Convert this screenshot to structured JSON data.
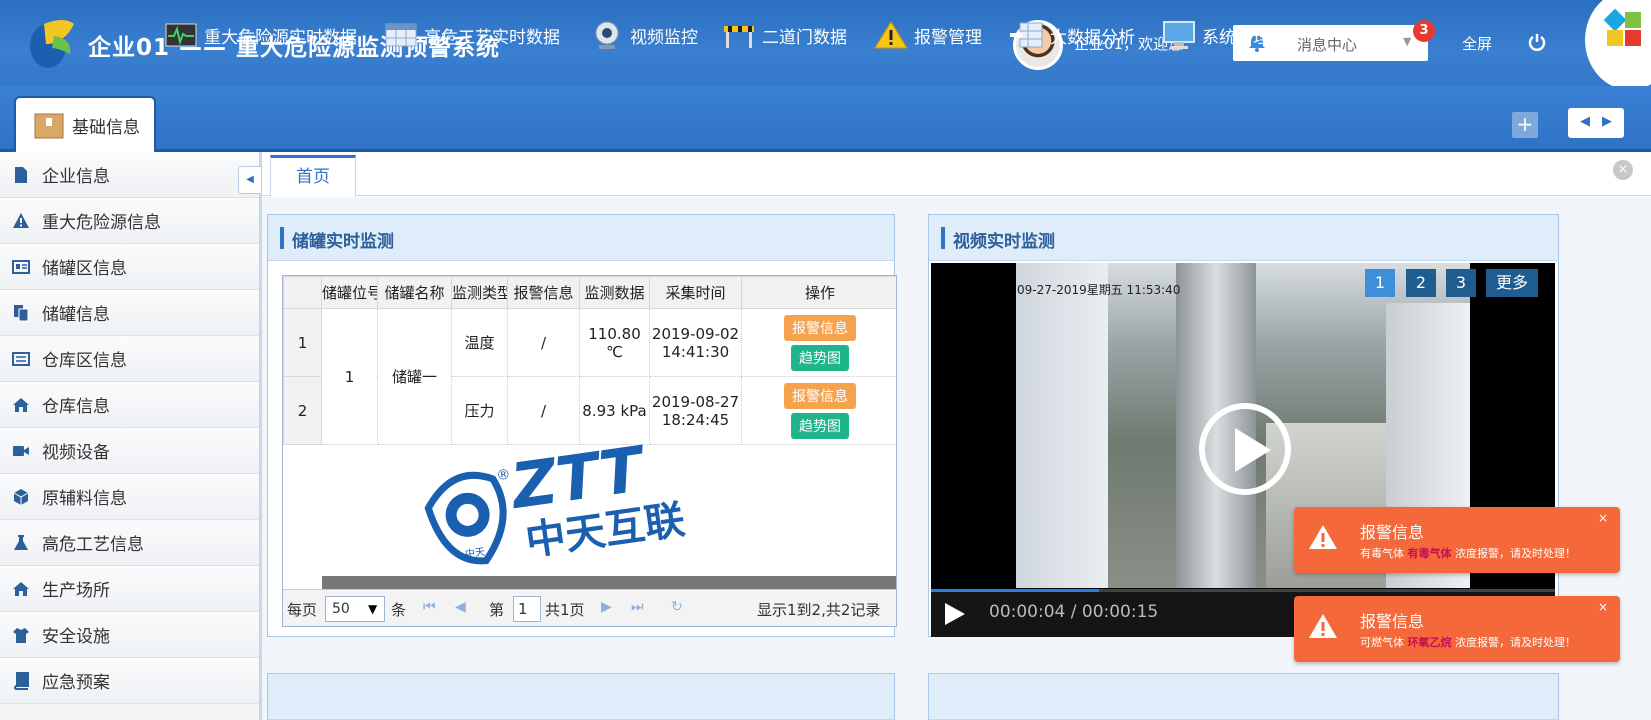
{
  "header": {
    "app_title": "企业01 —— 重大危险源监测预警系统",
    "welcome": "企业01，欢迎您",
    "message_center": "消息中心",
    "message_count": "3",
    "fullscreen": "全屏"
  },
  "nav": {
    "items": [
      {
        "label": "基础信息",
        "icon": "box-icon"
      },
      {
        "label": "重大危险源实时数据",
        "icon": "monitor-wave-icon"
      },
      {
        "label": "高危工艺实时数据",
        "icon": "grid-table-icon"
      },
      {
        "label": "视频监控",
        "icon": "webcam-icon"
      },
      {
        "label": "二道门数据",
        "icon": "barrier-gate-icon"
      },
      {
        "label": "报警管理",
        "icon": "warning-icon"
      },
      {
        "label": "大数据分析",
        "icon": "data-import-icon"
      },
      {
        "label": "系统管理",
        "icon": "computer-icon"
      }
    ],
    "plus": "+"
  },
  "sidebar": {
    "items": [
      {
        "label": "企业信息",
        "icon": "document-icon"
      },
      {
        "label": "重大危险源信息",
        "icon": "warning-icon"
      },
      {
        "label": "储罐区信息",
        "icon": "id-card-icon"
      },
      {
        "label": "储罐信息",
        "icon": "copy-icon"
      },
      {
        "label": "仓库区信息",
        "icon": "list-card-icon"
      },
      {
        "label": "仓库信息",
        "icon": "home-icon"
      },
      {
        "label": "视频设备",
        "icon": "video-camera-icon"
      },
      {
        "label": "原辅料信息",
        "icon": "cube-icon"
      },
      {
        "label": "高危工艺信息",
        "icon": "flask-icon"
      },
      {
        "label": "生产场所",
        "icon": "home-icon"
      },
      {
        "label": "安全设施",
        "icon": "shirt-icon"
      },
      {
        "label": "应急预案",
        "icon": "book-icon"
      }
    ]
  },
  "tabs": {
    "home": "首页",
    "close": "×"
  },
  "tank_panel": {
    "title": "储罐实时监测",
    "columns": [
      "",
      "储罐位号",
      "储罐名称",
      "监测类型",
      "报警信息",
      "监测数据",
      "采集时间",
      "操作"
    ],
    "rows": [
      {
        "no": "1",
        "tank_no": "1",
        "tank_name": "储罐一",
        "type": "温度",
        "alarm": "/",
        "value": "110.80 ℃",
        "time": "2019-09-02 14:41:30",
        "btn_alarm": "报警信息",
        "btn_trend": "趋势图"
      },
      {
        "no": "2",
        "type": "压力",
        "alarm": "/",
        "value": "8.93 kPa",
        "time": "2019-08-27 18:24:45",
        "btn_alarm": "报警信息",
        "btn_trend": "趋势图"
      }
    ],
    "watermark_brand": "ZTT",
    "watermark_cn": "中天互联",
    "watermark_seal": "中天",
    "pager": {
      "per_page_label": "每页",
      "per_page_value": "50",
      "per_page_unit": "条",
      "page_prefix": "第",
      "page_value": "1",
      "page_total": "共1页",
      "summary": "显示1到2,共2记录"
    }
  },
  "video_panel": {
    "title": "视频实时监测",
    "timestamp": "09-27-2019星期五 11:53:40",
    "cameras": [
      "1",
      "2",
      "3"
    ],
    "more": "更多",
    "time": "00:00:04 / 00:00:15",
    "progress": 0.27
  },
  "toasts": [
    {
      "title": "报警信息",
      "pre": "有毒气体",
      "highlight": "有毒气体",
      "post": "浓度报警，请及时处理！",
      "close": "×"
    },
    {
      "title": "报警信息",
      "pre": "可燃气体",
      "highlight": "环氧乙烷",
      "post": "浓度报警，请及时处理！",
      "close": "×"
    }
  ],
  "colors": {
    "header_blue": "#2f73c6",
    "alarm_orange": "#f6a350",
    "trend_green": "#1eb58a",
    "toast_orange": "#f4683a"
  }
}
